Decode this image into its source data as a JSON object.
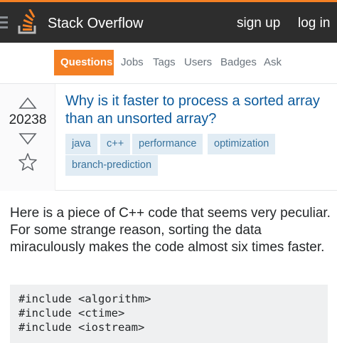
{
  "header": {
    "brand": "Stack Overflow",
    "sign_up": "sign up",
    "log_in": "log in",
    "accent_color": "#f48024",
    "bar_color": "#2d2d2d"
  },
  "nav": {
    "tabs": [
      {
        "label": "Questions",
        "active": true
      },
      {
        "label": "Jobs"
      },
      {
        "label": "Tags"
      },
      {
        "label": "Users"
      },
      {
        "label": "Badges"
      },
      {
        "label": "Ask"
      }
    ]
  },
  "question": {
    "score": "20238",
    "title": "Why is it faster to process a sorted array than an unsorted array?",
    "tags": [
      "java",
      "c++",
      "performance",
      "optimization",
      "branch-prediction"
    ],
    "body": "Here is a piece of C++ code that seems very peculiar. For some strange reason, sorting the data miraculously makes the code almost six times faster.",
    "code_lines": [
      "#include <algorithm>",
      "#include <ctime>",
      "#include <iostream>"
    ]
  }
}
